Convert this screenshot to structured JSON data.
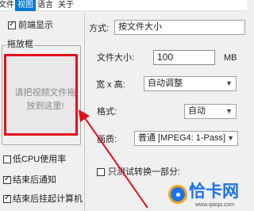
{
  "menu": {
    "items": [
      "文件",
      "视图",
      "语言",
      "关于"
    ],
    "active_index": 1
  },
  "left_panel": {
    "preview_checkbox": {
      "label": "前端显示",
      "checked": true
    },
    "drop_group_title": "拖放框",
    "drop_area_text": "请把视频文件拖放到这里!",
    "options": [
      {
        "label": "低CPU使用率",
        "checked": false
      },
      {
        "label": "结束后通知",
        "checked": true
      },
      {
        "label": "结束后挂起计算机",
        "checked": true
      }
    ]
  },
  "right_panel": {
    "mode_label": "方式:",
    "mode_value": "按文件大小",
    "file_size_label": "文件大小:",
    "file_size_value": "100",
    "file_size_unit": "MB",
    "dimension_label": "宽 x 高:",
    "dimension_value": "自动调整",
    "format_label": "格式:",
    "format_value": "自动",
    "quality_label": "画质:",
    "quality_value": "普通 [MPEG4: 1-Pass]",
    "test_convert": {
      "label": "只测试转换一部分:",
      "checked": false
    }
  },
  "watermark": {
    "text": "恰卡网",
    "url": "www.qiaqa.com"
  },
  "colors": {
    "accent": "#0078d7",
    "annotation_red": "#e3101c",
    "watermark_blue": "#1a73e8"
  }
}
